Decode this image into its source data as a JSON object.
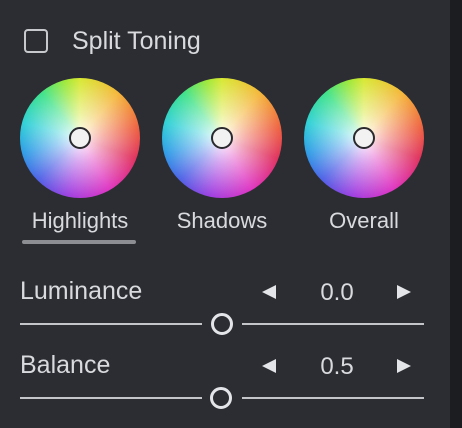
{
  "header": {
    "label": "Split Toning",
    "checked": false
  },
  "wheels": [
    {
      "label": "Highlights",
      "selected": true
    },
    {
      "label": "Shadows",
      "selected": false
    },
    {
      "label": "Overall",
      "selected": false
    }
  ],
  "luminance": {
    "label": "Luminance",
    "value": "0.0"
  },
  "balance": {
    "label": "Balance",
    "value": "0.5"
  },
  "colors": {
    "background": "#2c2d33",
    "text": "#d9dadd",
    "underline": "#8d8e93"
  },
  "icons": {
    "checkbox": "checkbox-icon",
    "decrement": "triangle-left-icon",
    "increment": "triangle-right-icon"
  }
}
